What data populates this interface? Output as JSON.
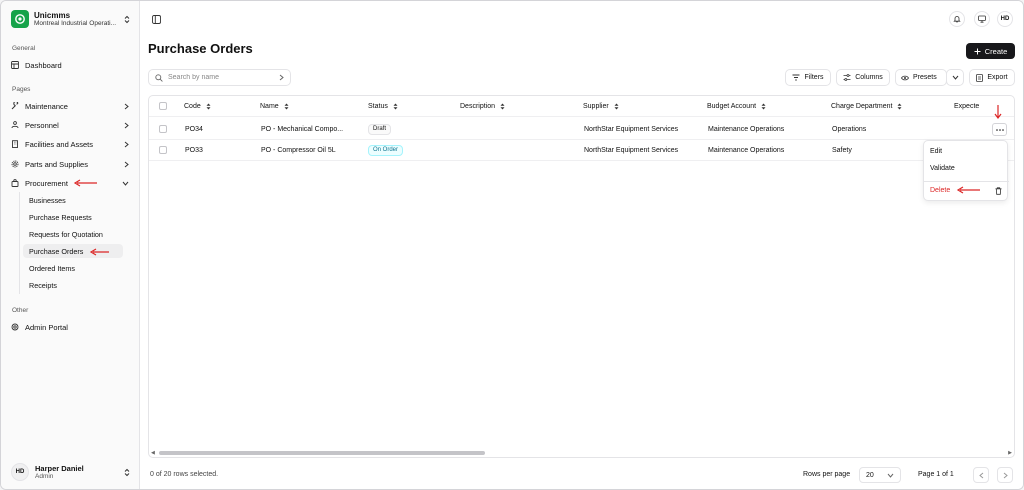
{
  "org": {
    "name": "Unicmms",
    "subtitle": "Montreal Industrial Operati..."
  },
  "sidebar": {
    "sections": {
      "general": "General",
      "pages": "Pages",
      "other": "Other"
    },
    "items": {
      "dashboard": "Dashboard",
      "maintenance": "Maintenance",
      "personnel": "Personnel",
      "facilities": "Facilities and Assets",
      "parts": "Parts and Supplies",
      "procurement": "Procurement",
      "admin": "Admin Portal"
    },
    "procurement_sub": [
      "Businesses",
      "Purchase Requests",
      "Requests for Quotation",
      "Purchase Orders",
      "Ordered Items",
      "Receipts"
    ]
  },
  "user": {
    "initials": "HD",
    "name": "Harper Daniel",
    "role": "Admin"
  },
  "header": {
    "avatar_initials": "HD"
  },
  "page": {
    "title": "Purchase Orders",
    "create_label": "Create"
  },
  "toolbar": {
    "search_placeholder": "Search by name",
    "filters": "Filters",
    "columns": "Columns",
    "presets": "Presets",
    "export": "Export"
  },
  "table": {
    "headers": [
      "Code",
      "Name",
      "Status",
      "Description",
      "Supplier",
      "Budget Account",
      "Charge Department",
      "Expecte"
    ],
    "rows": [
      {
        "code": "PO34",
        "name": "PO - Mechanical Compo...",
        "status": "Draft",
        "description": "",
        "supplier": "NorthStar Equipment Services",
        "budget": "Maintenance Operations",
        "department": "Operations"
      },
      {
        "code": "PO33",
        "name": "PO - Compressor Oil 5L",
        "status": "On Order",
        "description": "",
        "supplier": "NorthStar Equipment Services",
        "budget": "Maintenance Operations",
        "department": "Safety"
      }
    ]
  },
  "row_menu": {
    "edit": "Edit",
    "validate": "Validate",
    "delete": "Delete"
  },
  "footer": {
    "selection": "0 of 20 rows selected.",
    "rows_per_page_label": "Rows per page",
    "rows_per_page_value": "20",
    "page_info": "Page 1 of 1"
  },
  "colors": {
    "accent": "#18181b",
    "brand": "#16a34a",
    "danger": "#dc2626",
    "annotation": "#dc2626",
    "on_order": "#0e7490"
  }
}
